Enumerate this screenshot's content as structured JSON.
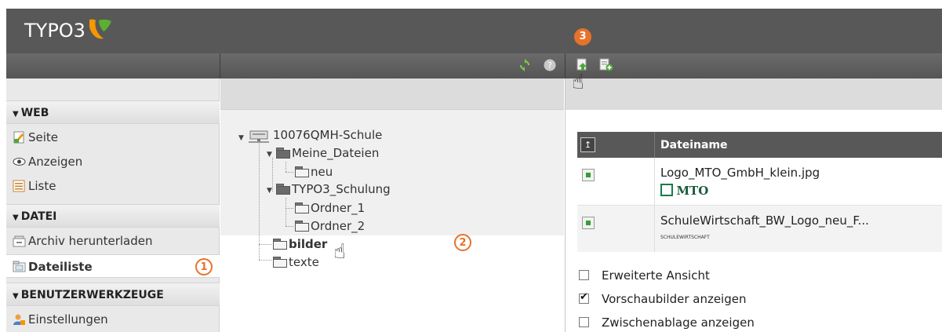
{
  "header": {
    "logo_text": "TYPO3"
  },
  "toolbar": {
    "left_icons": [
      "refresh-icon",
      "help-icon"
    ],
    "right_icons": [
      "upload-file-icon",
      "new-file-icon"
    ]
  },
  "sidebar": {
    "sections": [
      {
        "label": "WEB",
        "items": [
          {
            "label": "Seite",
            "icon": "page-icon"
          },
          {
            "label": "Anzeigen",
            "icon": "eye-icon"
          },
          {
            "label": "Liste",
            "icon": "list-icon"
          }
        ]
      },
      {
        "label": "DATEI",
        "items": [
          {
            "label": "Archiv herunterladen",
            "icon": "archive-icon"
          },
          {
            "label": "Dateiliste",
            "icon": "filelist-icon"
          }
        ]
      },
      {
        "label": "BENUTZERWERKZEUGE",
        "items": [
          {
            "label": "Einstellungen",
            "icon": "user-settings-icon"
          }
        ]
      }
    ]
  },
  "tree": {
    "root": "10076QMH-Schule",
    "nodes": [
      "Meine_Dateien",
      "neu",
      "TYPO3_Schulung",
      "Ordner_1",
      "Ordner_2",
      "bilder",
      "texte"
    ]
  },
  "filelist": {
    "column_header": "Dateiname",
    "files": [
      {
        "name": "Logo_MTO_GmbH_klein.jpg",
        "thumb_text": "MTO"
      },
      {
        "name": "SchuleWirtschaft_BW_Logo_neu_F...",
        "thumb_text": "SCHULEWIRTSCHAFT"
      }
    ]
  },
  "options": [
    {
      "label": "Erweiterte Ansicht",
      "checked": false
    },
    {
      "label": "Vorschaubilder anzeigen",
      "checked": true
    },
    {
      "label": "Zwischenablage anzeigen",
      "checked": false
    }
  ],
  "callouts": {
    "one": "1",
    "two": "2",
    "three": "3"
  },
  "colors": {
    "accent": "#e8722a",
    "header": "#585858",
    "typo3_orange": "#f49700"
  }
}
